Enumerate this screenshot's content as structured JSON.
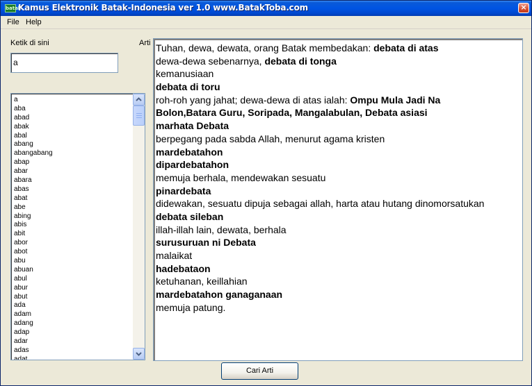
{
  "window": {
    "title": "Kamus Elektronik Batak-Indonesia ver 1.0     www.BatakToba.com",
    "icon_text": "batak",
    "close_label": "×"
  },
  "menu": {
    "items": [
      {
        "label": "File"
      },
      {
        "label": "Help"
      }
    ]
  },
  "search": {
    "label": "Ketik di sini",
    "value": "a"
  },
  "meaning_label": "Arti",
  "word_list": {
    "items": [
      "a",
      "aba",
      "abad",
      "abak",
      "abal",
      "abang",
      "abangabang",
      "abap",
      "abar",
      "abara",
      "abas",
      "abat",
      "abe",
      "abing",
      "abis",
      "abit",
      "abor",
      "abot",
      "abu",
      "abuan",
      "abul",
      "abur",
      "abut",
      "ada",
      "adam",
      "adang",
      "adap",
      "adar",
      "adas",
      "adat"
    ]
  },
  "meaning": {
    "lines": [
      [
        {
          "text": "Tuhan, dewa, dewata, orang Batak membedakan: ",
          "bold": false
        },
        {
          "text": "debata di atas",
          "bold": true
        }
      ],
      [
        {
          "text": "dewa-dewa sebenarnya, ",
          "bold": false
        },
        {
          "text": "debata di tonga",
          "bold": true
        }
      ],
      [
        {
          "text": "kemanusiaan",
          "bold": false
        }
      ],
      [
        {
          "text": "debata di toru",
          "bold": true
        }
      ],
      [
        {
          "text": "roh-roh yang jahat; dewa-dewa di atas ialah: ",
          "bold": false
        },
        {
          "text": "Ompu Mula Jadi Na",
          "bold": true
        }
      ],
      [
        {
          "text": "Bolon,Batara Guru, Soripada, Mangalabulan, Debata asiasi",
          "bold": true
        }
      ],
      [
        {
          "text": "marhata Debata",
          "bold": true
        }
      ],
      [
        {
          "text": "berpegang pada sabda Allah, menurut agama kristen",
          "bold": false
        }
      ],
      [
        {
          "text": "mardebatahon",
          "bold": true
        }
      ],
      [
        {
          "text": " dipardebatahon",
          "bold": true
        }
      ],
      [
        {
          "text": "memuja berhala, mendewakan sesuatu",
          "bold": false
        }
      ],
      [
        {
          "text": "pinardebata",
          "bold": true
        }
      ],
      [
        {
          "text": "didewakan, sesuatu dipuja sebagai allah, harta atau hutang dinomorsatukan",
          "bold": false
        }
      ],
      [
        {
          "text": "debata sileban",
          "bold": true
        }
      ],
      [
        {
          "text": "illah-illah lain, dewata, berhala",
          "bold": false
        }
      ],
      [
        {
          "text": "surusuruan ni Debata",
          "bold": true
        }
      ],
      [
        {
          "text": "malaikat",
          "bold": false
        }
      ],
      [
        {
          "text": "hadebataon",
          "bold": true
        }
      ],
      [
        {
          "text": "ketuhanan, keillahian",
          "bold": false
        }
      ],
      [
        {
          "text": "mardebatahon ganaganaan",
          "bold": true
        }
      ],
      [
        {
          "text": "memuja patung.",
          "bold": false
        }
      ]
    ]
  },
  "button": {
    "label": "Cari Arti"
  }
}
